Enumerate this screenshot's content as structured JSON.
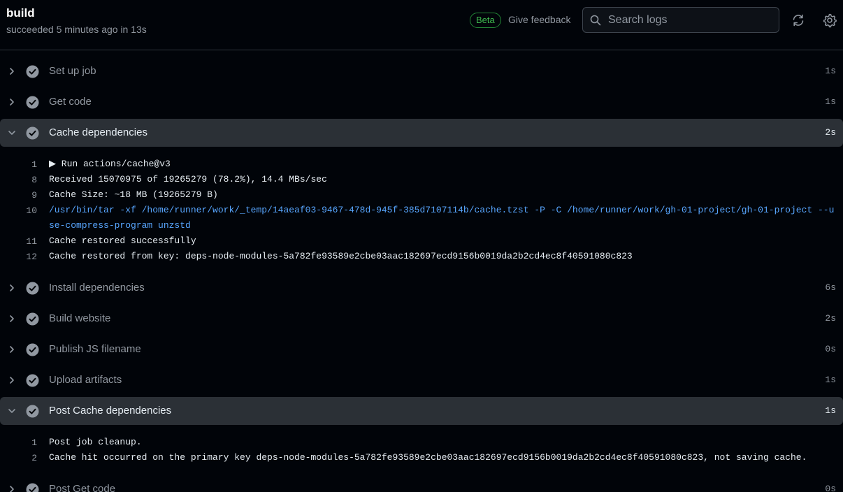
{
  "header": {
    "title": "build",
    "subtitle": "succeeded 5 minutes ago in 13s",
    "beta_label": "Beta",
    "feedback_label": "Give feedback",
    "search_placeholder": "Search logs"
  },
  "steps": [
    {
      "name": "Set up job",
      "time": "1s",
      "expanded": false
    },
    {
      "name": "Get code",
      "time": "1s",
      "expanded": false
    },
    {
      "name": "Cache dependencies",
      "time": "2s",
      "expanded": true
    },
    {
      "name": "Install dependencies",
      "time": "6s",
      "expanded": false
    },
    {
      "name": "Build website",
      "time": "2s",
      "expanded": false
    },
    {
      "name": "Publish JS filename",
      "time": "0s",
      "expanded": false
    },
    {
      "name": "Upload artifacts",
      "time": "1s",
      "expanded": false
    },
    {
      "name": "Post Cache dependencies",
      "time": "1s",
      "expanded": true
    },
    {
      "name": "Post Get code",
      "time": "0s",
      "expanded": false
    }
  ],
  "logs": {
    "cache": [
      {
        "n": "1",
        "text": "▶ Run actions/cache@v3"
      },
      {
        "n": "8",
        "text": "Received 15070975 of 19265279 (78.2%), 14.4 MBs/sec"
      },
      {
        "n": "9",
        "text": "Cache Size: ~18 MB (19265279 B)"
      },
      {
        "n": "10",
        "text": "/usr/bin/tar -xf /home/runner/work/_temp/14aeaf03-9467-478d-945f-385d7107114b/cache.tzst -P -C /home/runner/work/gh-01-project/gh-01-project --use-compress-program unzstd"
      },
      {
        "n": "11",
        "text": "Cache restored successfully"
      },
      {
        "n": "12",
        "text": "Cache restored from key: deps-node-modules-5a782fe93589e2cbe03aac182697ecd9156b0019da2b2cd4ec8f40591080c823"
      }
    ],
    "post_cache": [
      {
        "n": "1",
        "text": "Post job cleanup."
      },
      {
        "n": "2",
        "text": "Cache hit occurred on the primary key deps-node-modules-5a782fe93589e2cbe03aac182697ecd9156b0019da2b2cd4ec8f40591080c823, not saving cache."
      }
    ]
  }
}
